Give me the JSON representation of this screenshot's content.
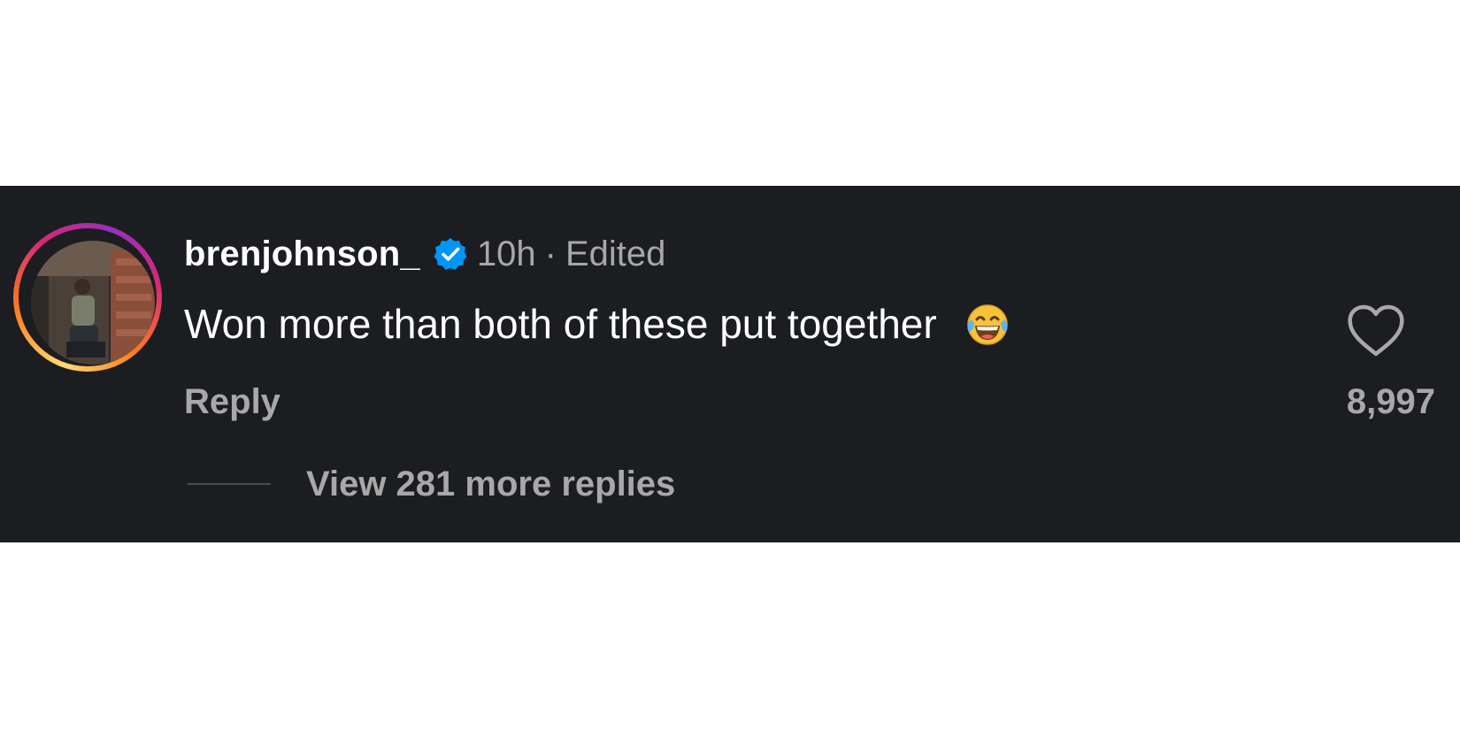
{
  "comment": {
    "username": "brenjohnson_",
    "verified_icon": "verified-badge-icon",
    "time": "10h",
    "separator": "·",
    "edited_label": "Edited",
    "text": "Won more than both of these put together",
    "emoji_icon": "face-with-tears-of-joy-icon",
    "reply_label": "Reply",
    "like_icon": "heart-outline-icon",
    "like_count": "8,997",
    "view_replies_label": "View 281 more replies"
  },
  "colors": {
    "panel_background": "#1b1d21",
    "primary_text": "#ffffff",
    "secondary_text": "#a8a8a8",
    "verified_blue": "#0095f6"
  }
}
